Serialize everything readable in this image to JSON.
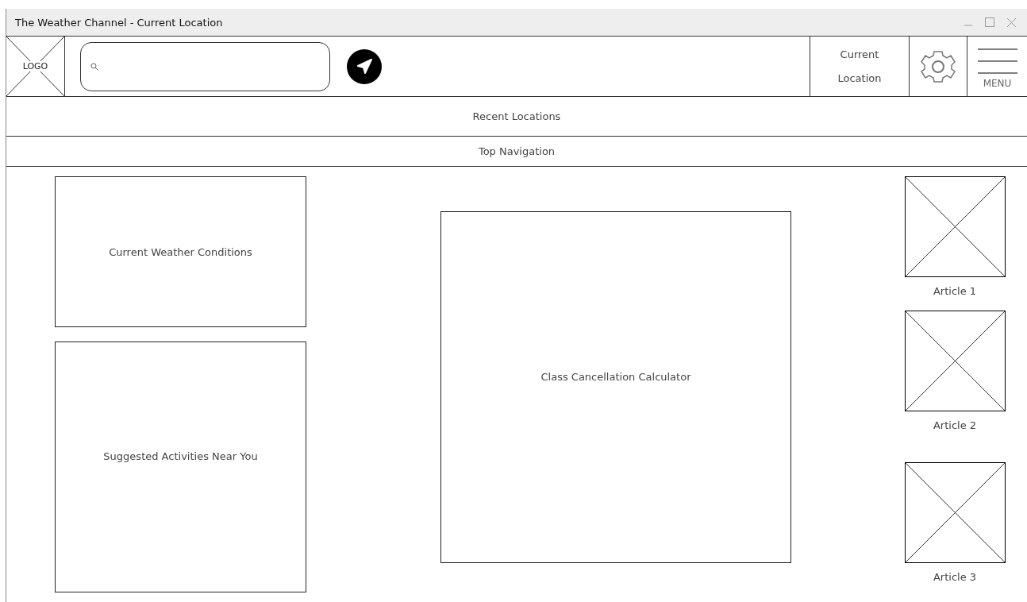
{
  "window": {
    "title": "The Weather Channel - Current Location"
  },
  "header": {
    "logo": "LOGO",
    "location_link": "Current Location",
    "menu": "MENU"
  },
  "bars": [
    "Recent Locations",
    "Top Navigation"
  ],
  "panels": {
    "weather": "Current Weather Conditions",
    "activities": "Suggested Activities Near You",
    "calculator": "Class Cancellation Calculator"
  },
  "articles": [
    {
      "title": "Article 1"
    },
    {
      "title": "Article 2"
    },
    {
      "title": "Article 3"
    }
  ]
}
